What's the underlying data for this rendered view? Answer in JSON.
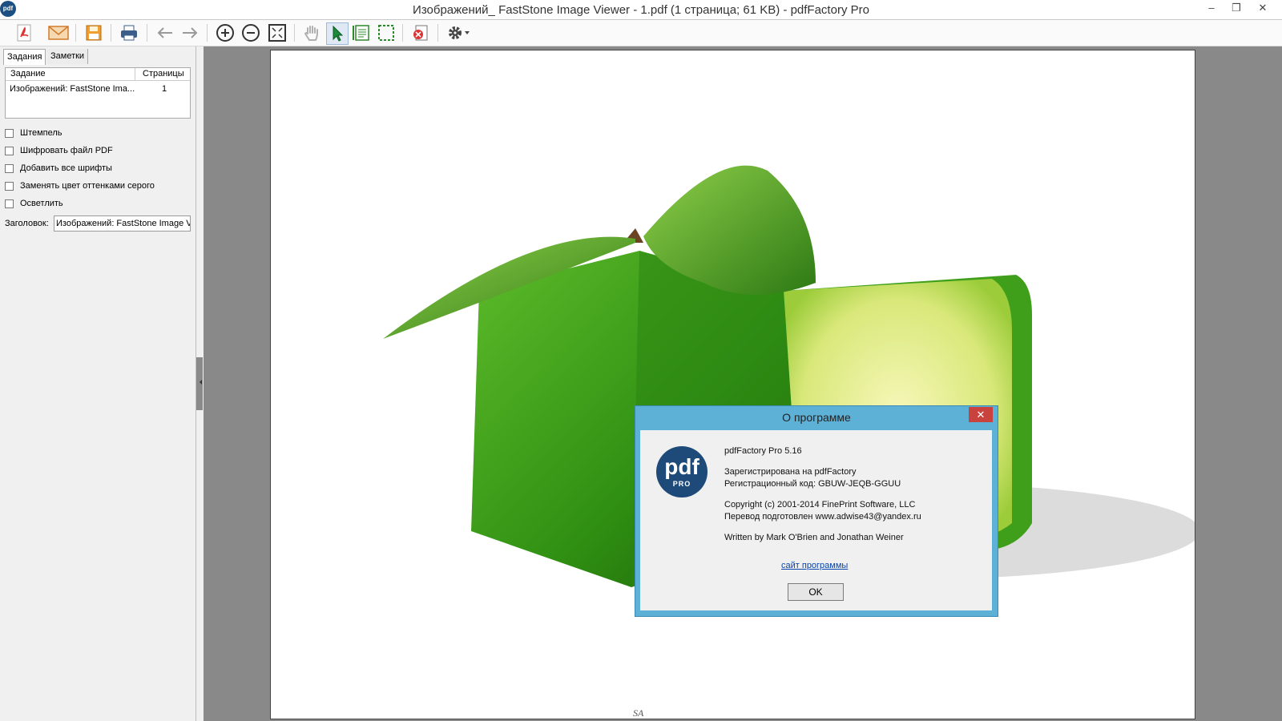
{
  "window": {
    "title": "Изображений_ FastStone Image Viewer - 1.pdf (1 страница; 61 KB) - pdfFactory Pro",
    "app_icon_text": "pdf"
  },
  "toolbar": {
    "buttons": [
      "pdf-icon",
      "email-icon",
      "save-icon",
      "print-icon",
      "back-arrow-icon",
      "forward-arrow-icon",
      "zoom-in-icon",
      "zoom-out-icon",
      "fit-page-icon",
      "hand-icon",
      "select-arrow-icon",
      "select-text-icon",
      "select-area-icon",
      "delete-page-icon",
      "settings-icon"
    ]
  },
  "left_panel": {
    "tabs": [
      {
        "label": "Задания"
      },
      {
        "label": "Заметки"
      }
    ],
    "job_list": {
      "columns": [
        "Задание",
        "Страницы"
      ],
      "rows": [
        {
          "job": "Изображений: FastStone Ima...",
          "pages": "1"
        }
      ]
    },
    "options": [
      {
        "label": "Штемпель",
        "checked": false
      },
      {
        "label": "Шифровать файл PDF",
        "checked": false
      },
      {
        "label": "Добавить все шрифты",
        "checked": false
      },
      {
        "label": "Заменять цвет оттенками серого",
        "checked": false
      },
      {
        "label": "Осветлить",
        "checked": false
      }
    ],
    "header_label": "Заголовок:",
    "header_value": "Изображений: FastStone Image V"
  },
  "page": {
    "footer_text": "SA"
  },
  "about_dialog": {
    "title": "О программе",
    "close": "✕",
    "logo_main": "pdf",
    "logo_sub": "PRO",
    "product": "pdfFactory Pro 5.16",
    "registered": "Зарегистрирована на pdfFactory",
    "reg_code": "Регистрационный код: GBUW-JEQB-GGUU",
    "copyright": "Copyright (c) 2001-2014 FinePrint Software, LLC",
    "translation": "Перевод подготовлен www.adwise43@yandex.ru",
    "authors": "Written by Mark O'Brien and Jonathan Weiner",
    "link": "сайт программы",
    "ok": "OK"
  },
  "colors": {
    "dialog_frame": "#5db0d6",
    "close_button": "#c9423d",
    "logo": "#1d4a78",
    "viewer_bg": "#898989"
  }
}
